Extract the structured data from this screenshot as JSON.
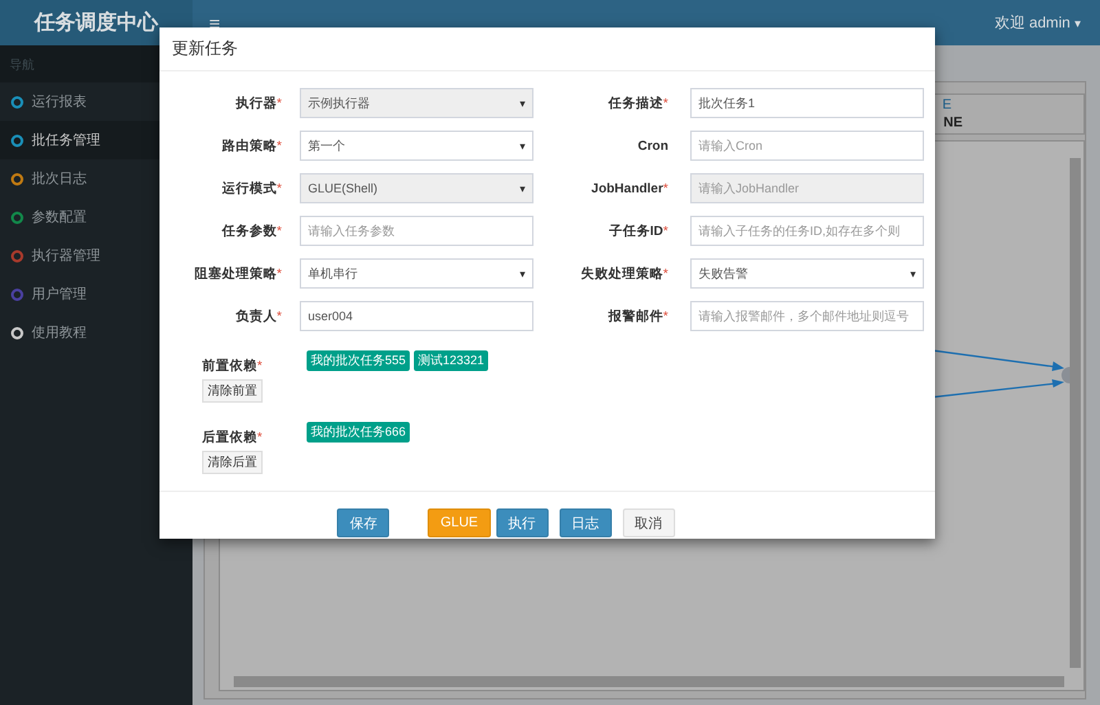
{
  "app": {
    "title": "任务调度中心",
    "menu_toggle": "≡",
    "user": "欢迎 admin",
    "user_caret": "▾"
  },
  "sidebar": {
    "heading": "导航",
    "items": [
      {
        "label": "运行报表",
        "color": "#1a8fb8",
        "selected": false
      },
      {
        "label": "批任务管理",
        "color": "#1a8fb8",
        "selected": true
      },
      {
        "label": "批次日志",
        "color": "#c07a12",
        "selected": false
      },
      {
        "label": "参数配置",
        "color": "#12884a",
        "selected": false
      },
      {
        "label": "执行器管理",
        "color": "#a83a2c",
        "selected": false
      },
      {
        "label": "用户管理",
        "color": "#4a40a0",
        "selected": false
      },
      {
        "label": "使用教程",
        "color": "#c8c8c8",
        "selected": false
      }
    ]
  },
  "background_panel": {
    "header_fragment_1": "E",
    "header_fragment_2": "NE"
  },
  "modal": {
    "title": "更新任务",
    "fields": [
      {
        "label": "执行器",
        "mark": "*",
        "kind": "select",
        "value": "示例执行器",
        "arrow": "▾",
        "disabled": true
      },
      {
        "label": "任务描述",
        "mark": "*",
        "kind": "input",
        "value": "批次任务1",
        "disabled": false
      },
      {
        "label": "路由策略",
        "mark": "*",
        "kind": "select",
        "value": "第一个",
        "arrow": "▾",
        "disabled": false
      },
      {
        "label": "Cron",
        "kind": "input",
        "placeholder": "请输入Cron",
        "disabled": false
      },
      {
        "label": "运行模式",
        "mark": "*",
        "kind": "select",
        "value": "GLUE(Shell)",
        "arrow": "▾",
        "disabled": true
      },
      {
        "label": "JobHandler",
        "mark": "*",
        "kind": "input",
        "placeholder": "请输入JobHandler",
        "disabled": true
      },
      {
        "label": "任务参数",
        "mark": "*",
        "kind": "input",
        "placeholder": "请输入任务参数",
        "disabled": false
      },
      {
        "label": "子任务ID",
        "mark": "*",
        "kind": "input",
        "placeholder": "请输入子任务的任务ID,如存在多个则",
        "disabled": false
      },
      {
        "label": "阻塞处理策略",
        "mark": "*",
        "kind": "select",
        "value": "单机串行",
        "arrow": "▾",
        "disabled": false
      },
      {
        "label": "失败处理策略",
        "mark": "*",
        "kind": "select",
        "value": "失败告警",
        "arrow": "▾",
        "disabled": false
      },
      {
        "label": "负责人",
        "mark": "*",
        "kind": "input",
        "value": "user004",
        "disabled": false
      },
      {
        "label": "报警邮件",
        "mark": "*",
        "kind": "input",
        "placeholder": "请输入报警邮件，多个邮件地址则逗号",
        "disabled": false
      }
    ],
    "dependencies": [
      {
        "label": "前置依赖",
        "mark": "*",
        "tags": [
          "我的批次任务555",
          "测试123321"
        ],
        "clear_button": "清除前置"
      },
      {
        "label": "后置依赖",
        "mark": "*",
        "tags": [
          "我的批次任务666"
        ],
        "clear_button": "清除后置"
      }
    ],
    "buttons": [
      {
        "label": "保存",
        "kind": "primary"
      },
      {
        "label": "GLUE",
        "kind": "warning"
      },
      {
        "label": "执行",
        "kind": "primary"
      },
      {
        "label": "日志",
        "kind": "primary"
      },
      {
        "label": "取消",
        "kind": "default"
      }
    ]
  }
}
